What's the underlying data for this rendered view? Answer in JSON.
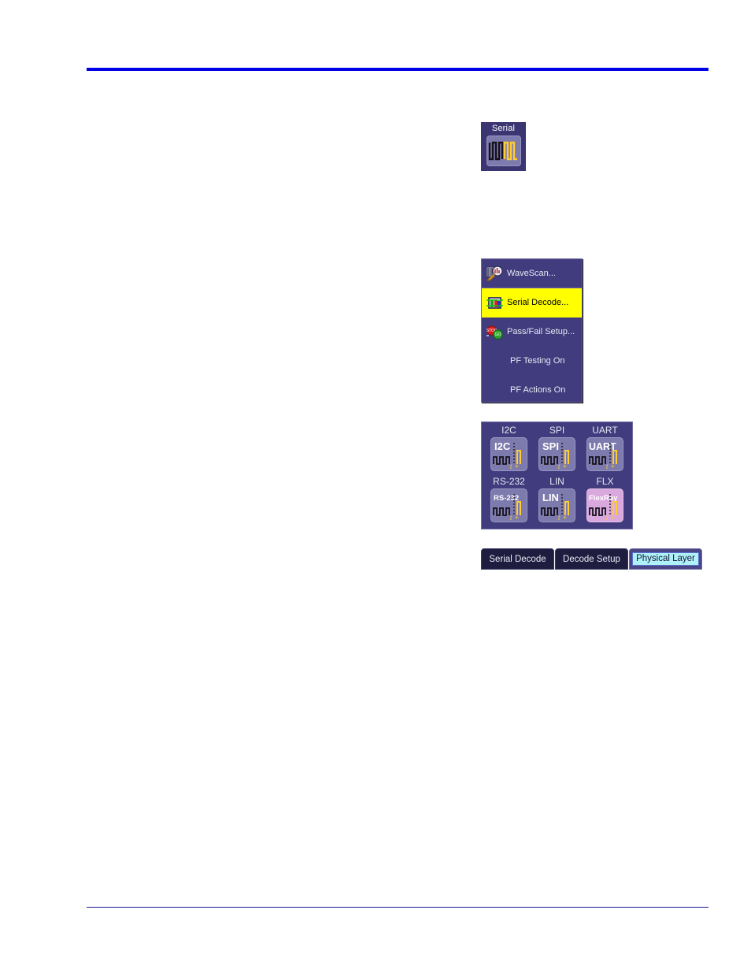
{
  "page": {
    "background": "#ffffff",
    "top_rule_color": "#0000e6",
    "bottom_rule_color": "#1b1b8f"
  },
  "serial_button_panel": {
    "name": "serial-toolbar-button",
    "caption": "Serial",
    "panel_color": "#3b3672",
    "button_color": "#7d7aad",
    "waveform_black": "#15121c",
    "waveform_yellow": "#ffcc33"
  },
  "analysis_menu": {
    "name": "analysis-dropdown-menu",
    "background": "#413c7d",
    "border_color": "#6f6ba6",
    "highlight_color": "#ffff00",
    "items": [
      {
        "label": "WaveScan...",
        "icon": "wavescan-icon",
        "selected": false,
        "has_icon": true
      },
      {
        "label": "Serial Decode...",
        "icon": "serial-decode-icon",
        "selected": true,
        "has_icon": true
      },
      {
        "label": "Pass/Fail Setup...",
        "icon": "pass-fail-icon",
        "selected": false,
        "has_icon": true
      },
      {
        "label": "PF Testing On",
        "icon": "",
        "selected": false,
        "has_icon": false
      },
      {
        "label": "PF Actions On",
        "icon": "",
        "selected": false,
        "has_icon": false
      }
    ]
  },
  "protocol_panel": {
    "name": "serial-protocol-selector",
    "background": "#413c7d",
    "button_color": "#7d7aad",
    "highlight_button_color": "#d9a8dd",
    "protocols": [
      {
        "caption": "I2C",
        "button_label": "I2C",
        "highlighted": false
      },
      {
        "caption": "SPI",
        "button_label": "SPI",
        "highlighted": false
      },
      {
        "caption": "UART",
        "button_label": "UART",
        "highlighted": false
      },
      {
        "caption": "RS-232",
        "button_label": "RS-232",
        "highlighted": false
      },
      {
        "caption": "LIN",
        "button_label": "LIN",
        "highlighted": false
      },
      {
        "caption": "FLX",
        "button_label": "FlexRay",
        "highlighted": true
      }
    ]
  },
  "tab_bar": {
    "name": "serial-decode-tabbar",
    "tabs": [
      {
        "label": "Serial Decode",
        "active": false
      },
      {
        "label": "Decode Setup",
        "active": false
      },
      {
        "label": "Physical Layer",
        "active": true
      }
    ],
    "active_tab_text_bg": "#aef2f7"
  }
}
